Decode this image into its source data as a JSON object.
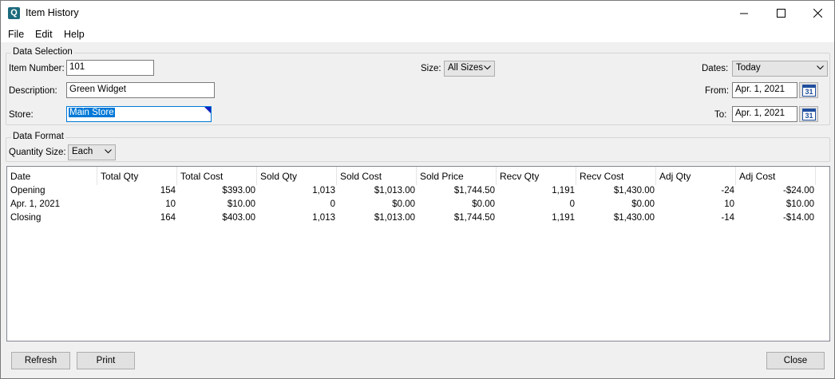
{
  "window": {
    "title": "Item History"
  },
  "menu": [
    "File",
    "Edit",
    "Help"
  ],
  "selection": {
    "title": "Data Selection",
    "item_number_label": "Item Number:",
    "item_number": "101",
    "description_label": "Description:",
    "description": "Green Widget",
    "store_label": "Store:",
    "store": "Main Store",
    "size_label": "Size:",
    "size": "All Sizes",
    "dates_label": "Dates:",
    "dates": "Today",
    "from_label": "From:",
    "from": "Apr. 1, 2021",
    "to_label": "To:",
    "to": "Apr. 1, 2021",
    "calendar_glyph": "31"
  },
  "format": {
    "title": "Data Format",
    "quantity_size_label": "Quantity Size:",
    "quantity_size": "Each"
  },
  "table": {
    "columns": [
      "Date",
      "Total Qty",
      "Total Cost",
      "Sold Qty",
      "Sold Cost",
      "Sold Price",
      "Recv Qty",
      "Recv Cost",
      "Adj Qty",
      "Adj Cost"
    ],
    "rows": [
      [
        "Opening",
        "154",
        "$393.00",
        "1,013",
        "$1,013.00",
        "$1,744.50",
        "1,191",
        "$1,430.00",
        "-24",
        "-$24.00"
      ],
      [
        "Apr. 1, 2021",
        "10",
        "$10.00",
        "0",
        "$0.00",
        "$0.00",
        "0",
        "$0.00",
        "10",
        "$10.00"
      ],
      [
        "Closing",
        "164",
        "$403.00",
        "1,013",
        "$1,013.00",
        "$1,744.50",
        "1,191",
        "$1,430.00",
        "-14",
        "-$14.00"
      ]
    ]
  },
  "buttons": {
    "refresh": "Refresh",
    "print": "Print",
    "close": "Close"
  }
}
